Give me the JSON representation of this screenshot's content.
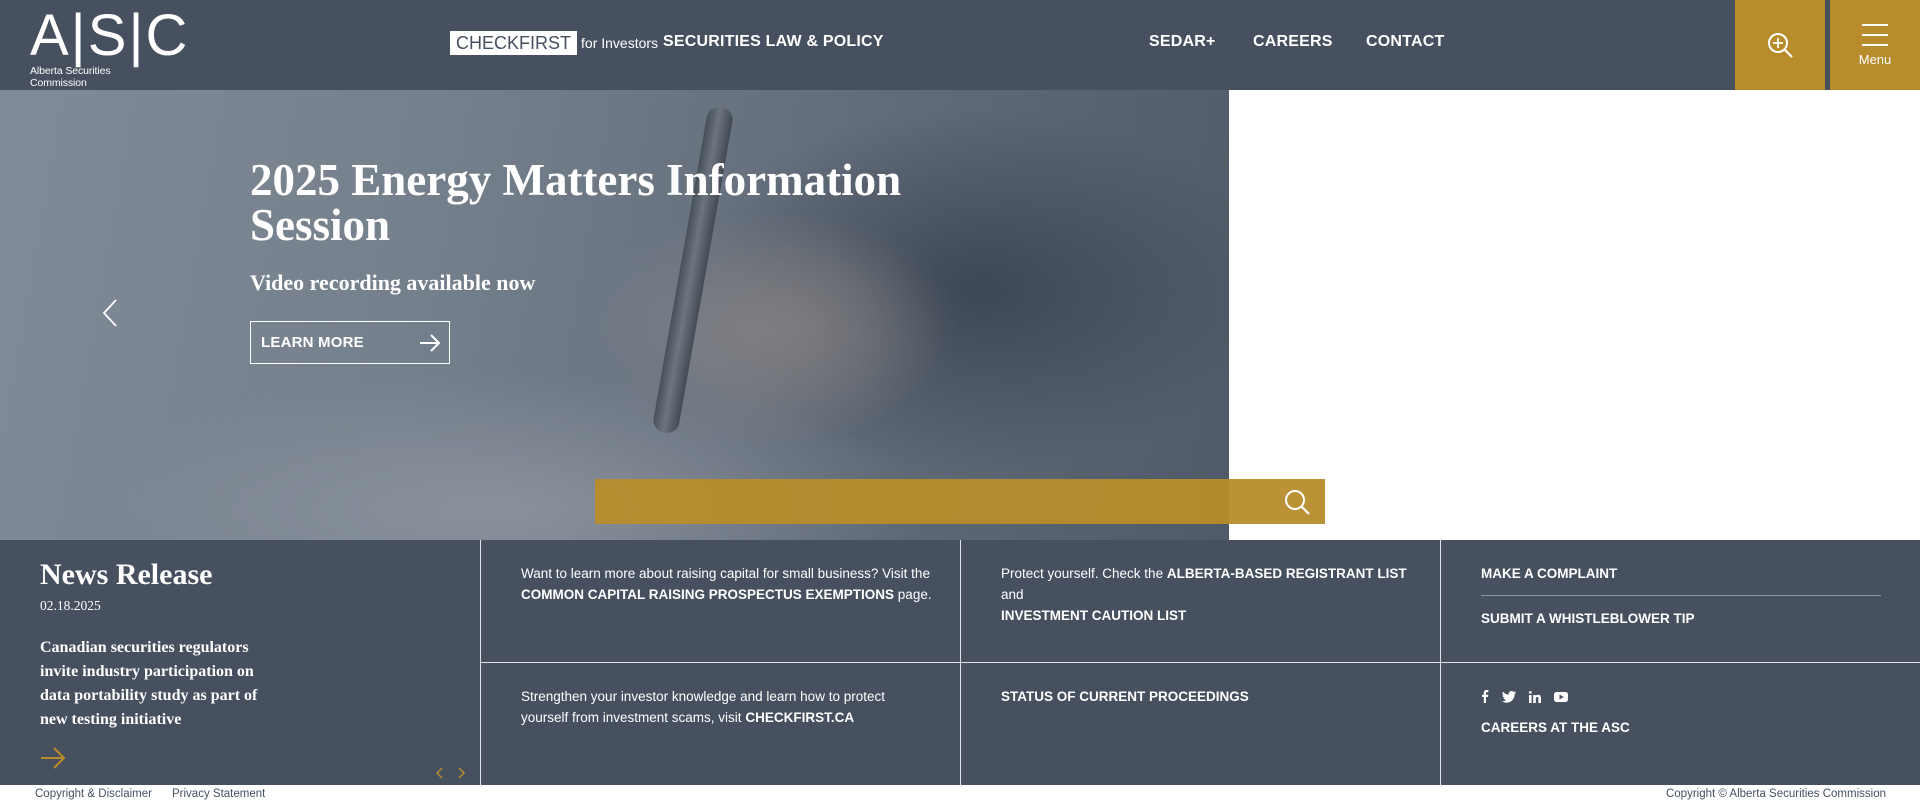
{
  "header": {
    "logo_mark": "A|S|C",
    "logo_sub": "Alberta Securities Commission",
    "checkfirst_box": "CHECKFIRST",
    "checkfirst_sub": "for Investors",
    "nav_securities": "SECURITIES LAW & POLICY",
    "nav_sedar": "SEDAR+",
    "nav_careers": "CAREERS",
    "nav_contact": "CONTACT",
    "menu_label": "Menu",
    "accent_color": "#b88c2b",
    "bar_color": "#46505f"
  },
  "hero": {
    "title": "2025 Energy Matters Information Session",
    "subtitle": "Video recording available now",
    "button_label": "LEARN MORE"
  },
  "search": {
    "placeholder": ""
  },
  "news": {
    "title": "News Release",
    "date": "02.18.2025",
    "headline": "Canadian securities regulators invite industry participation on data portability study as part of new testing initiative"
  },
  "tiles": {
    "capital_text_1": "Want to learn more about raising capital for small business? Visit the",
    "capital_link": "COMMON CAPITAL RAISING PROSPECTUS EXEMPTIONS",
    "capital_text_2": "page.",
    "protect_text_1": "Protect yourself. Check the",
    "protect_link_1": "ALBERTA-BASED REGISTRANT LIST",
    "protect_text_2": "and",
    "protect_link_2": "INVESTMENT CAUTION LIST",
    "complaint_link": "MAKE A COMPLAINT",
    "whistle_link": "SUBMIT A WHISTLEBLOWER TIP",
    "knowledge_text": "Strengthen your investor knowledge and learn how to protect yourself from investment scams, visit",
    "knowledge_link": "CHECKFIRST.CA",
    "proceedings_link": "STATUS OF CURRENT PROCEEDINGS",
    "careers_link": "CAREERS AT THE ASC"
  },
  "footer": {
    "copyright_link": "Copyright & Disclaimer",
    "privacy_link": "Privacy Statement",
    "copyright_text": "Copyright © Alberta Securities Commission"
  }
}
